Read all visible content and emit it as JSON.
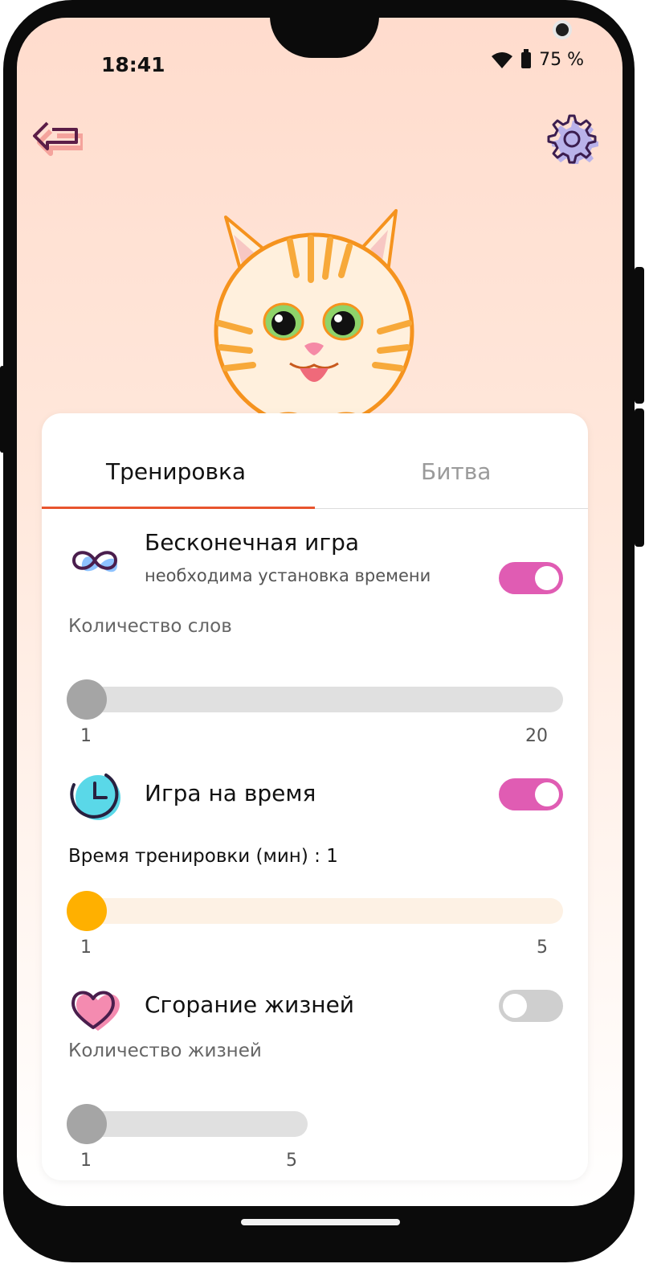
{
  "status": {
    "time": "18:41",
    "battery": "75 %"
  },
  "tabs": [
    {
      "label": "Тренировка",
      "active": true
    },
    {
      "label": "Битва",
      "active": false
    }
  ],
  "infinite": {
    "title": "Бесконечная игра",
    "subtitle": "необходима установка времени",
    "enabled": true
  },
  "words": {
    "label": "Количество слов",
    "min": "1",
    "max": "20",
    "value": 1
  },
  "timed": {
    "title": "Игра на время",
    "enabled": true
  },
  "time": {
    "label": "Время тренировки (мин) : 1",
    "min": "1",
    "max": "5",
    "value": 1
  },
  "lives_burn": {
    "title": "Сгорание жизней",
    "enabled": false
  },
  "lives": {
    "label": "Количество жизней",
    "min": "1",
    "max": "5",
    "value": 1
  },
  "colors": {
    "accent_pink": "#e05cb3",
    "accent_orange": "#ffb000",
    "tab_indicator": "#e8542e"
  }
}
